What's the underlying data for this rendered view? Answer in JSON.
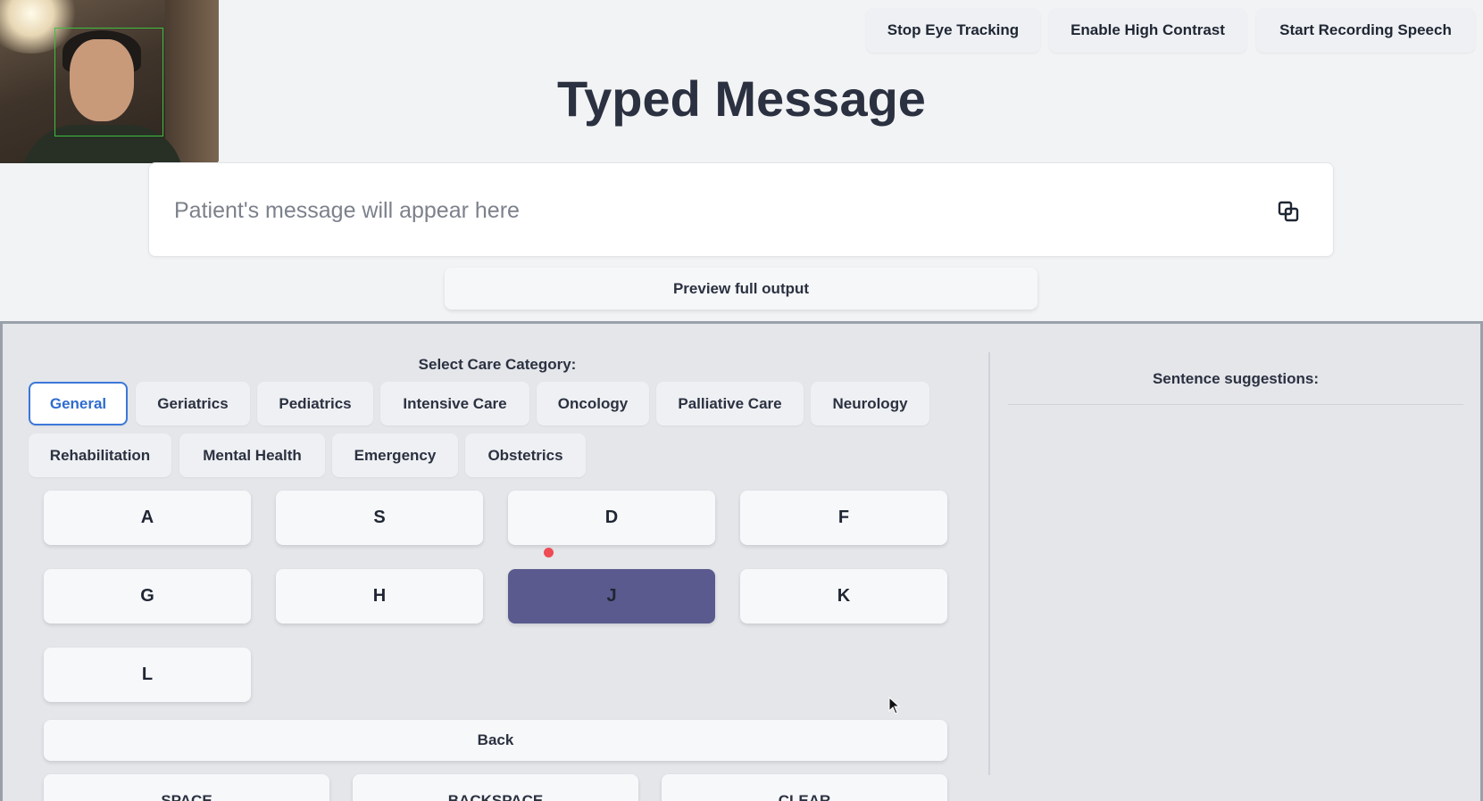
{
  "webcam": {
    "icon": "webcam-feed"
  },
  "toolbar": {
    "eye_tracking_label": "Stop Eye Tracking",
    "high_contrast_label": "Enable High Contrast",
    "record_speech_label": "Start Recording Speech"
  },
  "header": {
    "title": "Typed Message"
  },
  "message": {
    "placeholder": "Patient's message will appear here",
    "copy_icon": "copy-icon"
  },
  "preview": {
    "label": "Preview full output"
  },
  "categories": {
    "label": "Select Care Category:",
    "selected": "General",
    "items": [
      "General",
      "Geriatrics",
      "Pediatrics",
      "Intensive Care",
      "Oncology",
      "Palliative Care",
      "Neurology",
      "Rehabilitation",
      "Mental Health",
      "Emergency",
      "Obstetrics"
    ]
  },
  "keyboard": {
    "keys": [
      "A",
      "S",
      "D",
      "F",
      "G",
      "H",
      "J",
      "K",
      "L"
    ],
    "highlighted": "J",
    "back_label": "Back",
    "space_label": "SPACE",
    "backspace_label": "BACKSPACE",
    "clear_label": "CLEAR"
  },
  "suggestions": {
    "label": "Sentence suggestions:",
    "items": []
  },
  "colors": {
    "accent": "#3b77d9",
    "key_highlight": "#5a5a8e",
    "gaze_dot": "#ef4b55",
    "panel_bg": "#e4e6ea"
  }
}
